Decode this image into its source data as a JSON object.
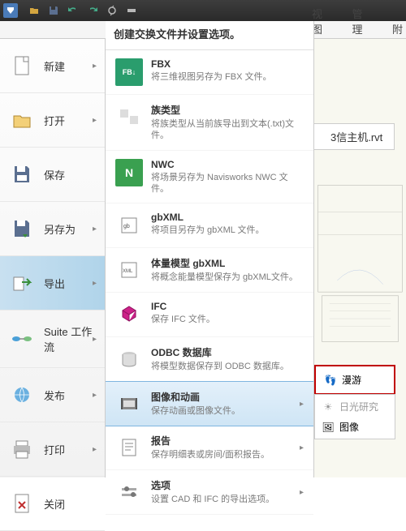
{
  "ribbon": {
    "tabs": [
      "视图",
      "管理",
      "附"
    ]
  },
  "app_menu": {
    "items": [
      {
        "label": "新建"
      },
      {
        "label": "打开"
      },
      {
        "label": "保存"
      },
      {
        "label": "另存为"
      },
      {
        "label": "导出"
      },
      {
        "label": "Suite 工作流"
      },
      {
        "label": "发布"
      },
      {
        "label": "打印"
      },
      {
        "label": "关闭"
      }
    ]
  },
  "export_panel": {
    "header": "创建交换文件并设置选项。",
    "items": [
      {
        "title": "FBX",
        "desc": "将三维视图另存为 FBX 文件。"
      },
      {
        "title": "族类型",
        "desc": "将族类型从当前族导出到文本(.txt)文件。"
      },
      {
        "title": "NWC",
        "desc": "将场景另存为 Navisworks NWC 文件。"
      },
      {
        "title": "gbXML",
        "desc": "将项目另存为 gbXML 文件。"
      },
      {
        "title": "体量模型 gbXML",
        "desc": "将概念能量模型保存为 gbXML文件。"
      },
      {
        "title": "IFC",
        "desc": "保存 IFC 文件。"
      },
      {
        "title": "ODBC 数据库",
        "desc": "将模型数据保存到 ODBC 数据库。"
      },
      {
        "title": "图像和动画",
        "desc": "保存动画或图像文件。"
      },
      {
        "title": "报告",
        "desc": "保存明细表或房间/面积报告。"
      },
      {
        "title": "选项",
        "desc": "设置 CAD 和 IFC 的导出选项。"
      }
    ]
  },
  "flyout": {
    "items": [
      {
        "label": "漫游"
      },
      {
        "label": "日光研究"
      },
      {
        "label": "图像"
      }
    ]
  },
  "filename": "3信主机.rvt",
  "colors": {
    "fbx": "#2a9d6d",
    "nwc": "#3aa050",
    "ifc": "#cc2288"
  }
}
